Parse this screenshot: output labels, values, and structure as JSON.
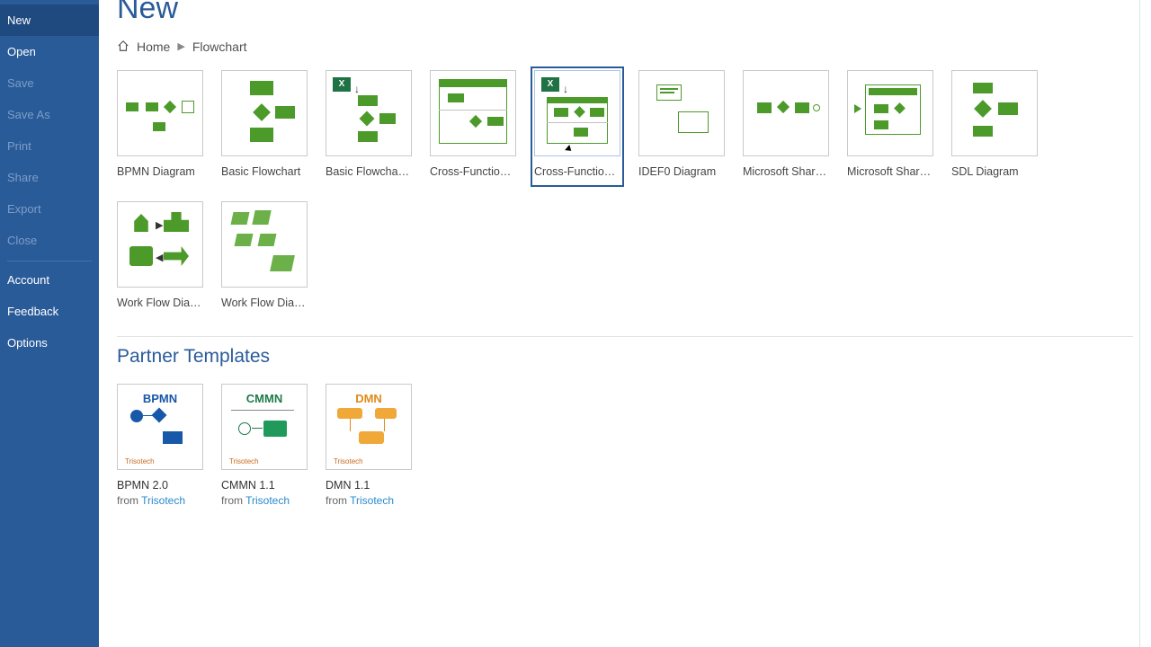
{
  "sidebar": {
    "items": [
      {
        "label": "New",
        "enabled": true,
        "selected": true
      },
      {
        "label": "Open",
        "enabled": true
      },
      {
        "label": "Save",
        "enabled": false
      },
      {
        "label": "Save As",
        "enabled": false
      },
      {
        "label": "Print",
        "enabled": false
      },
      {
        "label": "Share",
        "enabled": false
      },
      {
        "label": "Export",
        "enabled": false
      },
      {
        "label": "Close",
        "enabled": false
      }
    ],
    "bottom": [
      {
        "label": "Account"
      },
      {
        "label": "Feedback"
      },
      {
        "label": "Options"
      }
    ]
  },
  "header": {
    "title": "New",
    "breadcrumb": [
      "Home",
      "Flowchart"
    ]
  },
  "templates": [
    {
      "label": "BPMN Diagram"
    },
    {
      "label": "Basic Flowchart"
    },
    {
      "label": "Basic Flowchart…"
    },
    {
      "label": "Cross-Functional…"
    },
    {
      "label": "Cross-Functional…",
      "hovered": true
    },
    {
      "label": "IDEF0 Diagram"
    },
    {
      "label": "Microsoft Share…"
    },
    {
      "label": "Microsoft Share…"
    },
    {
      "label": "SDL Diagram"
    },
    {
      "label": "Work Flow Diagr…"
    },
    {
      "label": "Work Flow Diagr…"
    }
  ],
  "partnerSection": {
    "title": "Partner Templates",
    "items": [
      {
        "badge": "BPMN",
        "color": "#1858a8",
        "label": "BPMN 2.0",
        "prefix": "from ",
        "source": "Trisotech"
      },
      {
        "badge": "CMMN",
        "color": "#1f7a4a",
        "label": "CMMN 1.1",
        "prefix": "from ",
        "source": "Trisotech"
      },
      {
        "badge": "DMN",
        "color": "#e08a1a",
        "label": "DMN 1.1",
        "prefix": "from ",
        "source": "Trisotech"
      }
    ]
  }
}
